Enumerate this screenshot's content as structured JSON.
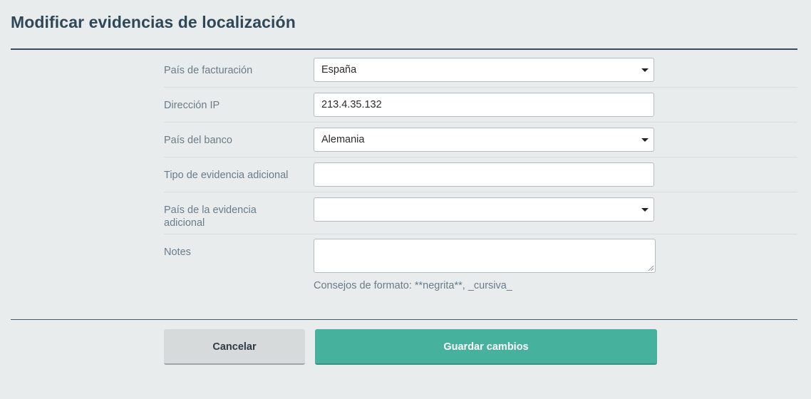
{
  "page": {
    "title": "Modificar evidencias de localización"
  },
  "form": {
    "billing_country": {
      "label": "País de facturación",
      "value": "España"
    },
    "ip_address": {
      "label": "Dirección IP",
      "value": "213.4.35.132"
    },
    "bank_country": {
      "label": "País del banco",
      "value": "Alemania"
    },
    "extra_evidence_type": {
      "label": "Tipo de evidencia adicional",
      "value": ""
    },
    "extra_evidence_country": {
      "label": "País de la evidencia adicional",
      "value": ""
    },
    "notes": {
      "label": "Notes",
      "value": ""
    },
    "format_hint": "Consejos de formato: **negrita**, _cursiva_"
  },
  "actions": {
    "cancel_label": "Cancelar",
    "save_label": "Guardar cambios"
  },
  "colors": {
    "background": "#e9ecec",
    "title": "#2f4858",
    "save_button": "#46b29d",
    "cancel_button": "#d6dadb"
  }
}
